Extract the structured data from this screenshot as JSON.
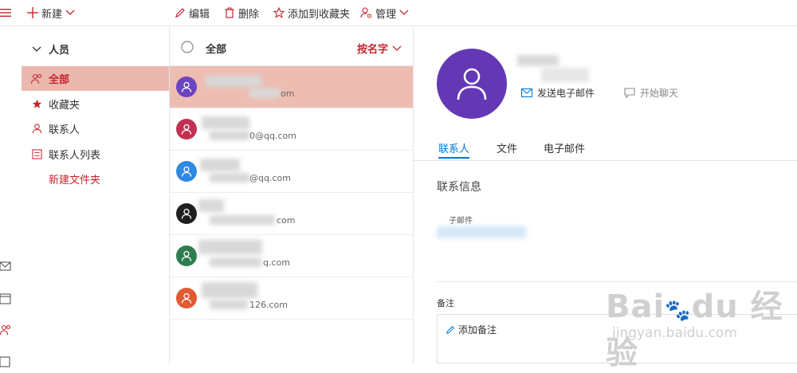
{
  "toolbar": {
    "new_label": "新建",
    "edit_label": "编辑",
    "delete_label": "删除",
    "favorite_label": "添加到收藏夹",
    "manage_label": "管理"
  },
  "folders": {
    "section_title": "人员",
    "items": [
      {
        "label": "全部",
        "icon": "people-icon",
        "active": true
      },
      {
        "label": "收藏夹",
        "icon": "star-icon"
      },
      {
        "label": "联系人",
        "icon": "person-icon"
      },
      {
        "label": "联系人列表",
        "icon": "contact-list-icon"
      }
    ],
    "new_folder_label": "新建文件夹"
  },
  "list": {
    "header_label": "全部",
    "sort_label": "按名字",
    "rows": [
      {
        "email_fragment": "om",
        "avatar_color": "#6b44c0"
      },
      {
        "email_fragment": "0@qq.com",
        "avatar_color": "#c23152"
      },
      {
        "email_fragment": "@qq.com",
        "avatar_color": "#2f88e2"
      },
      {
        "email_fragment": "com",
        "avatar_color": "#1f1f1f"
      },
      {
        "email_fragment": "q.com",
        "avatar_color": "#2e7d4f"
      },
      {
        "email_fragment": "126.com",
        "avatar_color": "#e05a33"
      }
    ]
  },
  "detail": {
    "avatar_color": "#6438b5",
    "send_email_label": "发送电子邮件",
    "start_chat_label": "开始聊天",
    "tabs": [
      "联系人",
      "文件",
      "电子邮件"
    ],
    "contact_info_heading": "联系信息",
    "email_field_label": "子邮件",
    "notes_label": "备注",
    "add_note_label": "添加备注"
  },
  "colors": {
    "accent_red": "#c4262e",
    "accent_blue": "#0078d4",
    "selection": "#eebdb2"
  }
}
